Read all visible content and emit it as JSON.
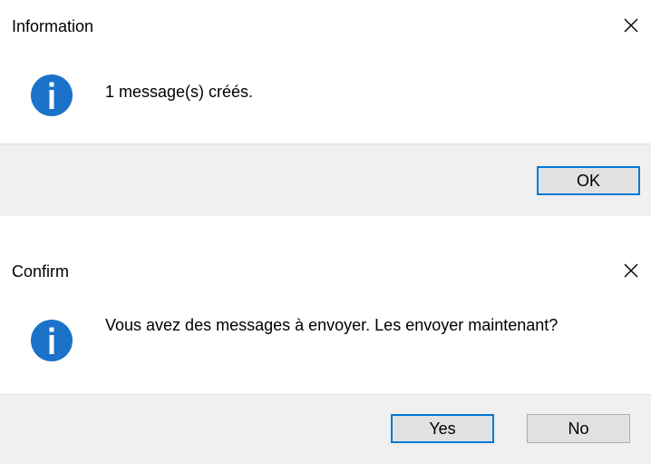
{
  "dialogs": [
    {
      "title": "Information",
      "icon": "info-icon",
      "message": "1 message(s) créés.",
      "buttons": [
        {
          "label": "OK",
          "default": true
        }
      ]
    },
    {
      "title": "Confirm",
      "icon": "info-icon",
      "message": "Vous avez des messages à envoyer. Les envoyer maintenant?",
      "buttons": [
        {
          "label": "Yes",
          "default": true
        },
        {
          "label": "No",
          "default": false
        }
      ]
    }
  ],
  "colors": {
    "accent": "#0078d7",
    "icon_blue": "#1a73c9",
    "footer_bg": "#f0f0f0",
    "button_bg": "#e1e1e1",
    "button_border": "#adadad"
  }
}
